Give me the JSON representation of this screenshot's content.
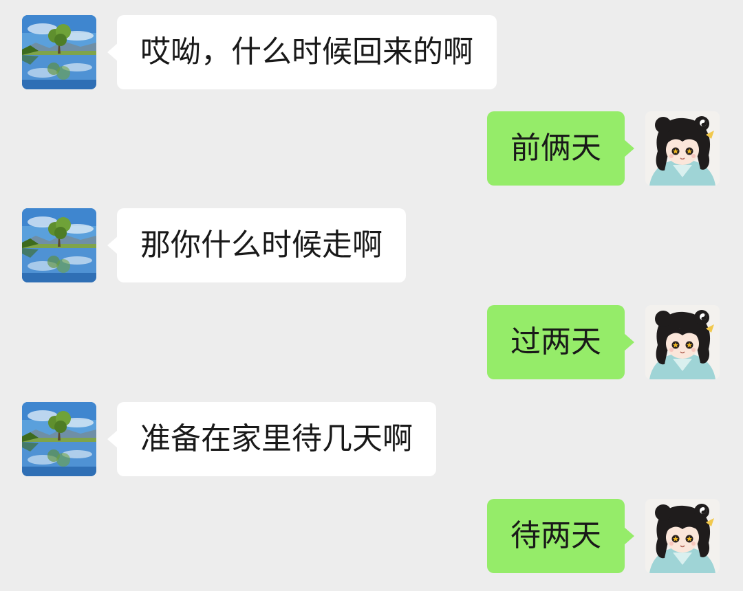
{
  "colors": {
    "background": "#ededed",
    "incoming_bubble": "#ffffff",
    "outgoing_bubble": "#95ec69",
    "text": "#191919"
  },
  "messages": [
    {
      "sender": "contact",
      "avatar": "landscape-avatar",
      "text": "哎呦，什么时候回来的啊"
    },
    {
      "sender": "me",
      "avatar": "anime-girl-avatar",
      "text": "前俩天"
    },
    {
      "sender": "contact",
      "avatar": "landscape-avatar",
      "text": "那你什么时候走啊"
    },
    {
      "sender": "me",
      "avatar": "anime-girl-avatar",
      "text": "过两天"
    },
    {
      "sender": "contact",
      "avatar": "landscape-avatar",
      "text": "准备在家里待几天啊"
    },
    {
      "sender": "me",
      "avatar": "anime-girl-avatar",
      "text": "待两天"
    }
  ]
}
